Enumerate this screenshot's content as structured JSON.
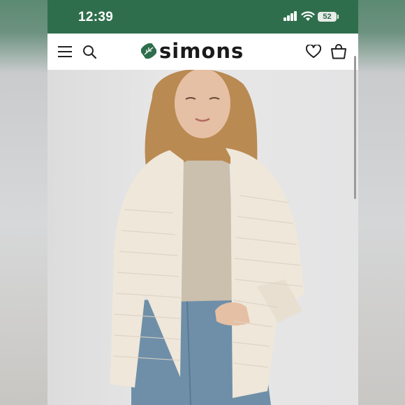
{
  "status_bar": {
    "time": "12:39",
    "battery": "52"
  },
  "header": {
    "logo": "simons"
  },
  "icons": {
    "menu": "menu-icon",
    "search": "search-icon",
    "wishlist": "heart-icon",
    "bag": "shopping-bag-icon",
    "logo_mark": "leaf-icon"
  },
  "colors": {
    "status_bar": "#2f6e4c",
    "cardigan": "#efe7da",
    "turtleneck": "#cbbfae",
    "jeans": "#6f8fa8"
  }
}
